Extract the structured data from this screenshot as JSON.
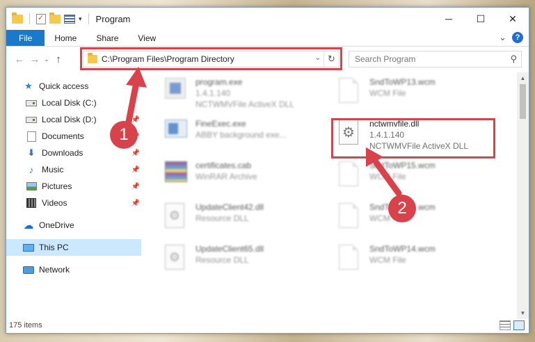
{
  "window": {
    "title": "Program",
    "controls": {
      "minimize": "─",
      "maximize": "☐",
      "close": "✕"
    }
  },
  "ribbon": {
    "tabs": [
      "File",
      "Home",
      "Share",
      "View"
    ],
    "expand": "⌄",
    "help": "?"
  },
  "nav": {
    "back": "←",
    "forward": "→",
    "recent": "⌄",
    "up": "↑",
    "address": "C:\\Program Files\\Program Directory",
    "address_dropdown": "⌄",
    "refresh": "↻",
    "search_placeholder": "Search Program",
    "search_icon": "⚲"
  },
  "sidebar": {
    "items": [
      {
        "label": "Quick access",
        "icon": "star-icon",
        "pinned": false
      },
      {
        "label": "Local Disk (C:)",
        "icon": "drive-icon",
        "pinned": false
      },
      {
        "label": "Local Disk (D:)",
        "icon": "drive-icon",
        "pinned": true
      },
      {
        "label": "Documents",
        "icon": "documents-icon",
        "pinned": true
      },
      {
        "label": "Downloads",
        "icon": "downloads-icon",
        "pinned": true
      },
      {
        "label": "Music",
        "icon": "music-icon",
        "pinned": true
      },
      {
        "label": "Pictures",
        "icon": "pictures-icon",
        "pinned": true
      },
      {
        "label": "Videos",
        "icon": "videos-icon",
        "pinned": true
      },
      {
        "label": "OneDrive",
        "icon": "onedrive-icon",
        "pinned": false
      },
      {
        "label": "This PC",
        "icon": "this-pc-icon",
        "pinned": false,
        "selected": true
      },
      {
        "label": "Network",
        "icon": "network-icon",
        "pinned": false
      }
    ],
    "pin_glyph": "📌"
  },
  "files": [
    {
      "name": "program.exe",
      "line1": "1.4.1.140",
      "line2": "NCTWMVFile ActiveX DLL",
      "icon": "exe-icon"
    },
    {
      "name": "SndToWP13.wcm",
      "line1": "WCM File",
      "line2": "",
      "icon": "document-icon"
    },
    {
      "name": "FineExec.exe",
      "line1": "ABBY background exe...",
      "line2": "",
      "icon": "abby-icon"
    },
    {
      "name": "nctwmvfile.dll",
      "line1": "1.4.1.140",
      "line2": "NCTWMVFile ActiveX DLL",
      "icon": "dll-gear-icon",
      "highlighted": true
    },
    {
      "name": "certificates.cab",
      "line1": "WinRAR Archive",
      "line2": "",
      "icon": "winrar-icon"
    },
    {
      "name": "SndToWP15.wcm",
      "line1": "WCM File",
      "line2": "",
      "icon": "document-icon"
    },
    {
      "name": "UpdateClient42.dll",
      "line1": "Resource DLL",
      "line2": "",
      "icon": "dll-icon"
    },
    {
      "name": "SndToWP16.wcm",
      "line1": "WCM File",
      "line2": "",
      "icon": "document-icon"
    },
    {
      "name": "UpdateClient65.dll",
      "line1": "Resource DLL",
      "line2": "",
      "icon": "dll-icon"
    },
    {
      "name": "SndToWP14.wcm",
      "line1": "WCM File",
      "line2": "",
      "icon": "document-icon"
    }
  ],
  "status": {
    "items": "175 items"
  },
  "annotations": {
    "step1": "1",
    "step2": "2",
    "color": "#d8434b"
  }
}
